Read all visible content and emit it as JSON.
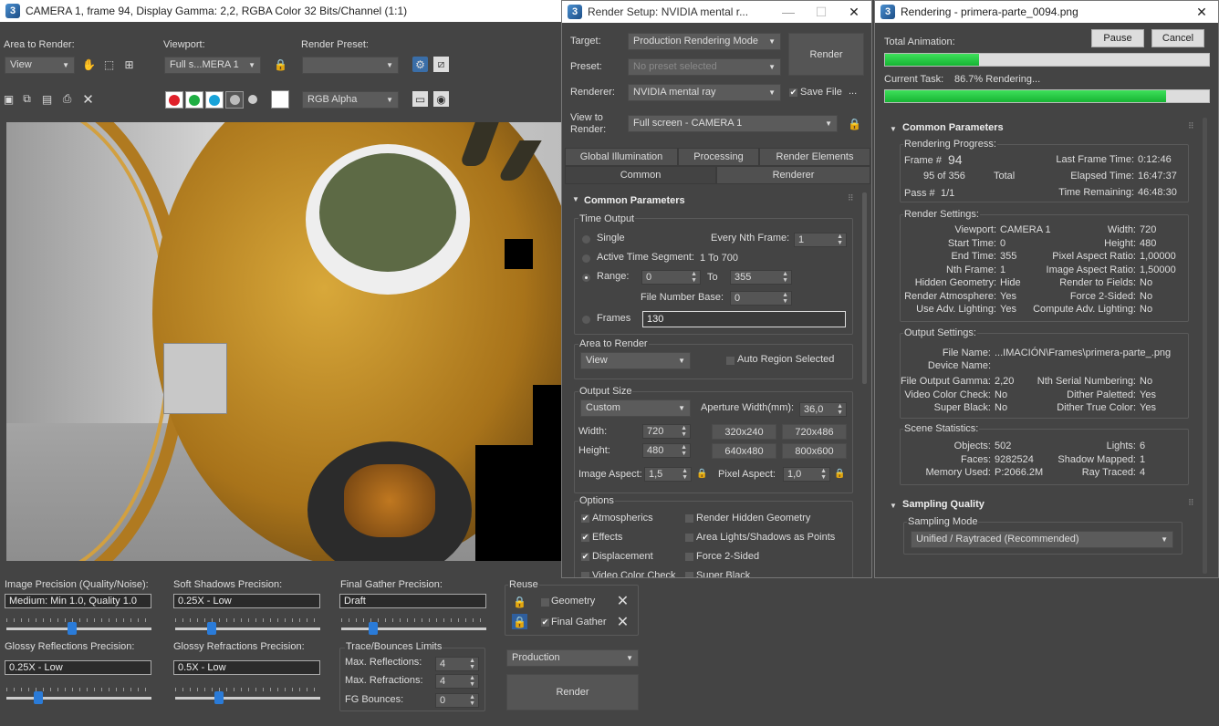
{
  "frame_window": {
    "title": "CAMERA 1, frame 94, Display Gamma: 2,2, RGBA Color 32 Bits/Channel (1:1)",
    "area_to_render_label": "Area to Render:",
    "area_to_render_value": "View",
    "viewport_label": "Viewport:",
    "viewport_value": "Full s...MERA 1",
    "render_preset_label": "Render Preset:",
    "render_preset_value": "",
    "channel_value": "RGB Alpha",
    "image_precision_label": "Image Precision (Quality/Noise):",
    "image_precision_value": "Medium: Min 1.0, Quality 1.0",
    "image_precision_level": 0.45,
    "soft_shadows_label": "Soft Shadows Precision:",
    "soft_shadows_value": "0.25X - Low",
    "soft_shadows_level": 0.25,
    "final_gather_label": "Final Gather Precision:",
    "final_gather_value": "Draft",
    "final_gather_level": 0.22,
    "glossy_reflections_label": "Glossy Reflections Precision:",
    "glossy_reflections_value": "0.25X - Low",
    "glossy_reflections_level": 0.22,
    "glossy_refractions_label": "Glossy Refractions Precision:",
    "glossy_refractions_value": "0.5X - Low",
    "glossy_refractions_level": 0.3,
    "reuse_label": "Reuse",
    "geometry_label": "Geometry",
    "final_gather_reuse_label": "Final Gather",
    "final_gather_checked": true,
    "geometry_checked": false,
    "trace_label": "Trace/Bounces Limits",
    "max_reflections_label": "Max. Reflections:",
    "max_reflections_value": "4",
    "max_refractions_label": "Max. Refractions:",
    "max_refractions_value": "4",
    "fg_bounces_label": "FG Bounces:",
    "fg_bounces_value": "0",
    "production_value": "Production",
    "render_button": "Render"
  },
  "render_setup": {
    "title": "Render Setup: NVIDIA mental r...",
    "target_label": "Target:",
    "target_value": "Production Rendering Mode",
    "preset_label": "Preset:",
    "preset_value": "No preset selected",
    "renderer_label": "Renderer:",
    "renderer_value": "NVIDIA mental ray",
    "save_file_label": "Save File",
    "save_file_checked": true,
    "more_label": "...",
    "view_to_render_label": "View to Render:",
    "view_to_render_value": "Full screen - CAMERA 1",
    "render_button": "Render",
    "tabs_row1": [
      "Global Illumination",
      "Processing",
      "Render Elements"
    ],
    "tabs_row2": [
      "Common",
      "Renderer"
    ],
    "rollout_title": "Common Parameters",
    "time_output_label": "Time Output",
    "single_label": "Single",
    "every_nth_label": "Every Nth Frame:",
    "every_nth_value": "1",
    "active_segment_label": "Active Time Segment:",
    "active_segment_value": "1 To 700",
    "range_label": "Range:",
    "range_from": "0",
    "range_to_label": "To",
    "range_to": "355",
    "file_number_base_label": "File Number Base:",
    "file_number_base_value": "0",
    "frames_label": "Frames",
    "frames_value": "130",
    "area_to_render_label": "Area to Render",
    "area_to_render_value": "View",
    "auto_region_label": "Auto Region Selected",
    "output_size_label": "Output Size",
    "output_size_value": "Custom",
    "aperture_label": "Aperture Width(mm):",
    "aperture_value": "36,0",
    "width_label": "Width:",
    "width_value": "720",
    "height_label": "Height:",
    "height_value": "480",
    "presets": [
      "320x240",
      "720x486",
      "640x480",
      "800x600"
    ],
    "image_aspect_label": "Image Aspect:",
    "image_aspect_value": "1,5",
    "pixel_aspect_label": "Pixel Aspect:",
    "pixel_aspect_value": "1,0",
    "options_label": "Options",
    "options": [
      {
        "label": "Atmospherics",
        "checked": true
      },
      {
        "label": "Render Hidden Geometry",
        "checked": false
      },
      {
        "label": "Effects",
        "checked": true
      },
      {
        "label": "Area Lights/Shadows as Points",
        "checked": false
      },
      {
        "label": "Displacement",
        "checked": true
      },
      {
        "label": "Force 2-Sided",
        "checked": false
      },
      {
        "label": "Video Color Check",
        "checked": false
      },
      {
        "label": "Super Black",
        "checked": false
      }
    ]
  },
  "rendering": {
    "title": "Rendering - primera-parte_0094.png",
    "pause": "Pause",
    "cancel": "Cancel",
    "total_animation_label": "Total Animation:",
    "total_progress": 0.29,
    "current_task_label": "Current Task:",
    "current_task_value": "86.7%  Rendering...",
    "current_progress": 0.867,
    "common_params_title": "Common Parameters",
    "rendering_progress_label": "Rendering Progress:",
    "frame_label": "Frame #",
    "frame_value": "94",
    "frame_count": "95 of 356",
    "total_label": "Total",
    "pass_label": "Pass #",
    "pass_value": "1/1",
    "last_frame_time_label": "Last Frame Time:",
    "last_frame_time_value": "0:12:46",
    "elapsed_label": "Elapsed Time:",
    "elapsed_value": "16:47:37",
    "remaining_label": "Time Remaining:",
    "remaining_value": "46:48:30",
    "render_settings_label": "Render Settings:",
    "settings_left": [
      [
        "Viewport:",
        "CAMERA 1"
      ],
      [
        "Start Time:",
        "0"
      ],
      [
        "End Time:",
        "355"
      ],
      [
        "Nth Frame:",
        "1"
      ],
      [
        "Hidden Geometry:",
        "Hide"
      ],
      [
        "Render Atmosphere:",
        "Yes"
      ],
      [
        "Use Adv. Lighting:",
        "Yes"
      ]
    ],
    "settings_right": [
      [
        "Width:",
        "720"
      ],
      [
        "Height:",
        "480"
      ],
      [
        "Pixel Aspect Ratio:",
        "1,00000"
      ],
      [
        "Image Aspect Ratio:",
        "1,50000"
      ],
      [
        "Render to Fields:",
        "No"
      ],
      [
        "Force 2-Sided:",
        "No"
      ],
      [
        "Compute Adv. Lighting:",
        "No"
      ]
    ],
    "output_settings_label": "Output Settings:",
    "file_name_label": "File Name:",
    "file_name_value": "...IMACIÓN\\Frames\\primera-parte_.png",
    "device_name_label": "Device Name:",
    "output_left": [
      [
        "File Output Gamma:",
        "2,20"
      ],
      [
        "Video Color Check:",
        "No"
      ],
      [
        "Super Black:",
        "No"
      ]
    ],
    "output_right": [
      [
        "Nth Serial Numbering:",
        "No"
      ],
      [
        "Dither Paletted:",
        "Yes"
      ],
      [
        "Dither True Color:",
        "Yes"
      ]
    ],
    "scene_statistics_label": "Scene Statistics:",
    "stats_left": [
      [
        "Objects:",
        "502"
      ],
      [
        "Faces:",
        "9282524"
      ],
      [
        "Memory Used:",
        "P:2066.2M"
      ]
    ],
    "stats_right": [
      [
        "Lights:",
        "6"
      ],
      [
        "Shadow Mapped:",
        "1"
      ],
      [
        "Ray Traced:",
        "4"
      ]
    ],
    "sampling_title": "Sampling Quality",
    "sampling_mode_label": "Sampling Mode",
    "sampling_mode_value": "Unified / Raytraced (Recommended)"
  }
}
